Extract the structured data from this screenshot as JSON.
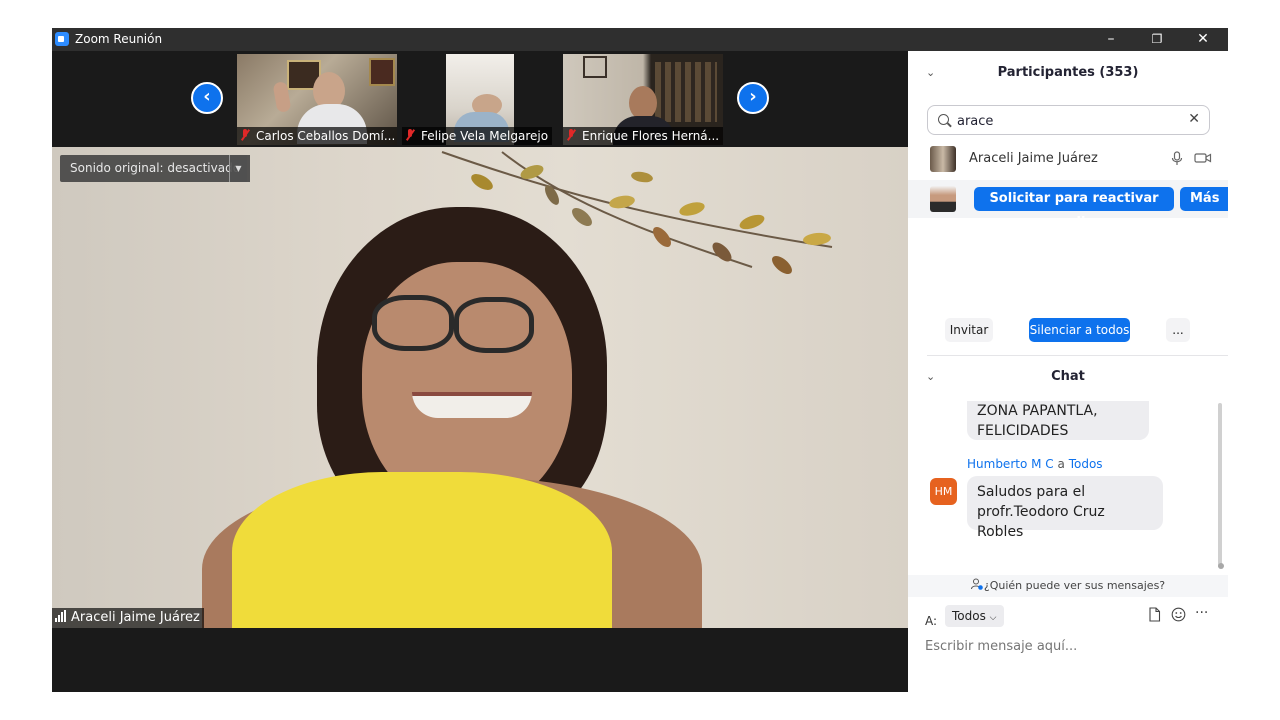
{
  "window": {
    "title": "Zoom Reunión",
    "controls": [
      "–",
      "❐",
      "✕"
    ]
  },
  "video": {
    "thumbnails": [
      {
        "name": "Carlos Ceballos Domí..."
      },
      {
        "name": "Felipe Vela Melgarejo"
      },
      {
        "name": "Enrique Flores Herná..."
      }
    ],
    "nav_prev": "‹",
    "nav_next": "›",
    "audio_toggle": "Sonido original: desactivado",
    "audio_arrow": "▼",
    "speaker_name": "Araceli Jaime Juárez"
  },
  "participants": {
    "header": "Participantes (353)",
    "search_value": "arace",
    "clear": "✕",
    "rows": [
      {
        "name": "Araceli Jaime Juárez"
      }
    ],
    "request_audio": "Solicitar para reactivar audio",
    "more": "Más",
    "invite": "Invitar",
    "mute_all": "Silenciar a todos",
    "ellipsis": "..."
  },
  "chat": {
    "header": "Chat",
    "prev_message": [
      "ZONA PAPANTLA,",
      "FELICIDADES"
    ],
    "sender": "Humberto M C",
    "sender_a": "a",
    "sender_to": "Todos",
    "avatar_initials": "HM",
    "message": [
      "Saludos para el",
      "profr.Teodoro Cruz Robles"
    ],
    "who_can_see": "¿Quién puede ver sus mensajes?",
    "to_label": "A:",
    "to_value": "Todos",
    "placeholder": "Escribir mensaje aquí..."
  },
  "colors": {
    "accent": "#0e72ed",
    "avatar_hm": "#e6621f",
    "muted_red": "#e02828"
  }
}
